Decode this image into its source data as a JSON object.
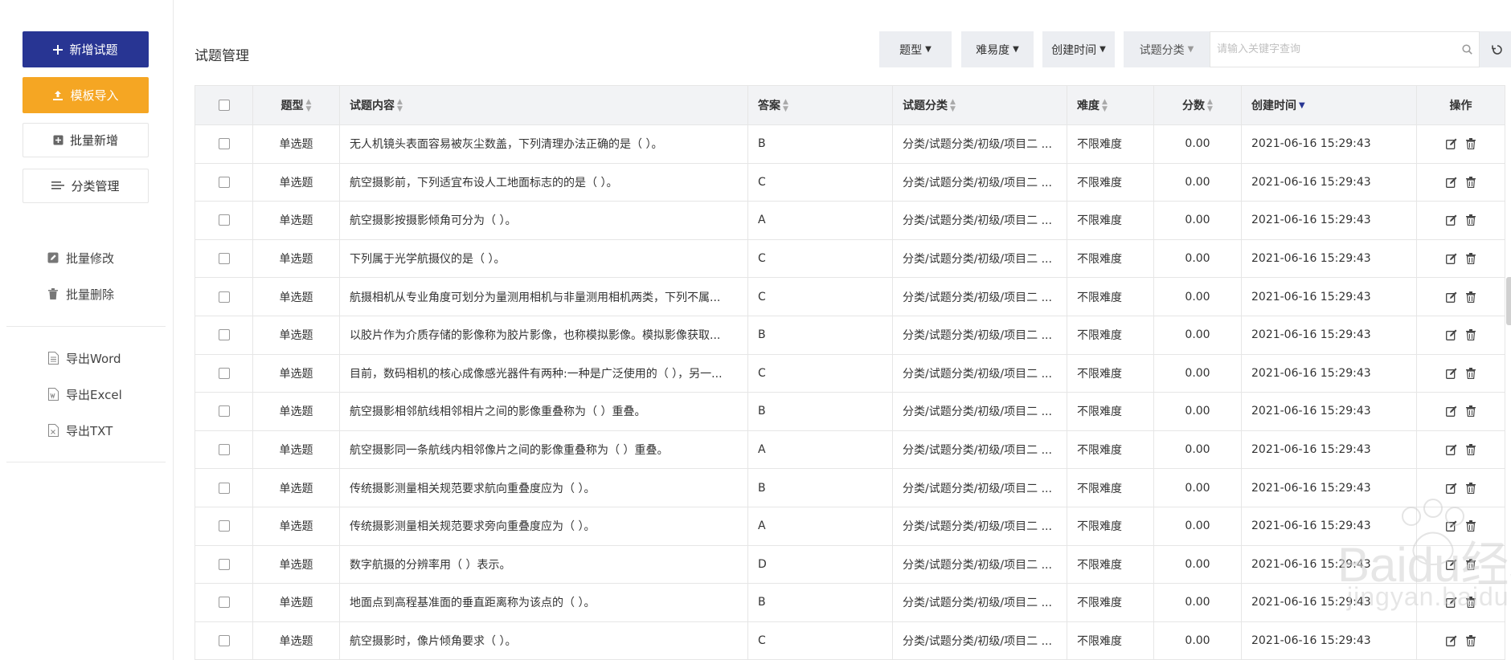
{
  "sidebar": {
    "add_question": "新增试题",
    "template_import": "模板导入",
    "batch_add": "批量新增",
    "category_manage": "分类管理",
    "batch_edit": "批量修改",
    "batch_delete": "批量删除",
    "export_word": "导出Word",
    "export_excel": "导出Excel",
    "export_txt": "导出TXT"
  },
  "header": {
    "title": "试题管理",
    "filters": {
      "type": "题型",
      "difficulty": "难易度",
      "created_time": "创建时间",
      "category": "试题分类"
    },
    "search_placeholder": "请输入关键字查询"
  },
  "table": {
    "columns": {
      "type": "题型",
      "content": "试题内容",
      "answer": "答案",
      "category": "试题分类",
      "difficulty": "难度",
      "score": "分数",
      "created_time": "创建时间",
      "ops": "操作"
    },
    "rows": [
      {
        "type": "单选题",
        "content": "无人机镜头表面容易被灰尘数盖，下列清理办法正确的是（ ）。",
        "answer": "B",
        "category": "分类/试题分类/初级/项目二 ...",
        "difficulty": "不限难度",
        "score": "0.00",
        "time": "2021-06-16 15:29:43"
      },
      {
        "type": "单选题",
        "content": "航空摄影前，下列适宜布设人工地面标志的的是（ ）。",
        "answer": "C",
        "category": "分类/试题分类/初级/项目二 ...",
        "difficulty": "不限难度",
        "score": "0.00",
        "time": "2021-06-16 15:29:43"
      },
      {
        "type": "单选题",
        "content": "航空摄影按摄影倾角可分为（ ）。",
        "answer": "A",
        "category": "分类/试题分类/初级/项目二 ...",
        "difficulty": "不限难度",
        "score": "0.00",
        "time": "2021-06-16 15:29:43"
      },
      {
        "type": "单选题",
        "content": "下列属于光学航摄仪的是（ ）。",
        "answer": "C",
        "category": "分类/试题分类/初级/项目二 ...",
        "difficulty": "不限难度",
        "score": "0.00",
        "time": "2021-06-16 15:29:43"
      },
      {
        "type": "单选题",
        "content": "航摄相机从专业角度可划分为量测用相机与非量测用相机两类，下列不属...",
        "answer": "C",
        "category": "分类/试题分类/初级/项目二 ...",
        "difficulty": "不限难度",
        "score": "0.00",
        "time": "2021-06-16 15:29:43"
      },
      {
        "type": "单选题",
        "content": "以胶片作为介质存储的影像称为胶片影像，也称模拟影像。模拟影像获取...",
        "answer": "B",
        "category": "分类/试题分类/初级/项目二 ...",
        "difficulty": "不限难度",
        "score": "0.00",
        "time": "2021-06-16 15:29:43"
      },
      {
        "type": "单选题",
        "content": "目前，数码相机的核心成像感光器件有两种:一种是广泛使用的（ ），另一...",
        "answer": "C",
        "category": "分类/试题分类/初级/项目二 ...",
        "difficulty": "不限难度",
        "score": "0.00",
        "time": "2021-06-16 15:29:43"
      },
      {
        "type": "单选题",
        "content": "航空摄影相邻航线相邻相片之间的影像重叠称为（ ）重叠。",
        "answer": "B",
        "category": "分类/试题分类/初级/项目二 ...",
        "difficulty": "不限难度",
        "score": "0.00",
        "time": "2021-06-16 15:29:43"
      },
      {
        "type": "单选题",
        "content": "航空摄影同一条航线内相邻像片之间的影像重叠称为（ ）重叠。",
        "answer": "A",
        "category": "分类/试题分类/初级/项目二 ...",
        "difficulty": "不限难度",
        "score": "0.00",
        "time": "2021-06-16 15:29:43"
      },
      {
        "type": "单选题",
        "content": "传统摄影测量相关规范要求航向重叠度应为（ ）。",
        "answer": "B",
        "category": "分类/试题分类/初级/项目二 ...",
        "difficulty": "不限难度",
        "score": "0.00",
        "time": "2021-06-16 15:29:43"
      },
      {
        "type": "单选题",
        "content": "传统摄影测量相关规范要求旁向重叠度应为（ ）。",
        "answer": "A",
        "category": "分类/试题分类/初级/项目二 ...",
        "difficulty": "不限难度",
        "score": "0.00",
        "time": "2021-06-16 15:29:43"
      },
      {
        "type": "单选题",
        "content": "数字航摄的分辨率用（ ）表示。",
        "answer": "D",
        "category": "分类/试题分类/初级/项目二 ...",
        "difficulty": "不限难度",
        "score": "0.00",
        "time": "2021-06-16 15:29:43"
      },
      {
        "type": "单选题",
        "content": "地面点到高程基准面的垂直距离称为该点的（ ）。",
        "answer": "B",
        "category": "分类/试题分类/初级/项目二 ...",
        "difficulty": "不限难度",
        "score": "0.00",
        "time": "2021-06-16 15:29:43"
      },
      {
        "type": "单选题",
        "content": "航空摄影时，像片倾角要求（ ）。",
        "answer": "C",
        "category": "分类/试题分类/初级/项目二 ...",
        "difficulty": "不限难度",
        "score": "0.00",
        "time": "2021-06-16 15:29:43"
      }
    ]
  },
  "watermark": {
    "brand": "Baidu经验",
    "url": "jingyan.baidu.com"
  },
  "colors": {
    "primary": "#283593",
    "orange": "#f5a623",
    "header_bg": "#f2f3f5",
    "filter_bg": "#eceef2"
  }
}
